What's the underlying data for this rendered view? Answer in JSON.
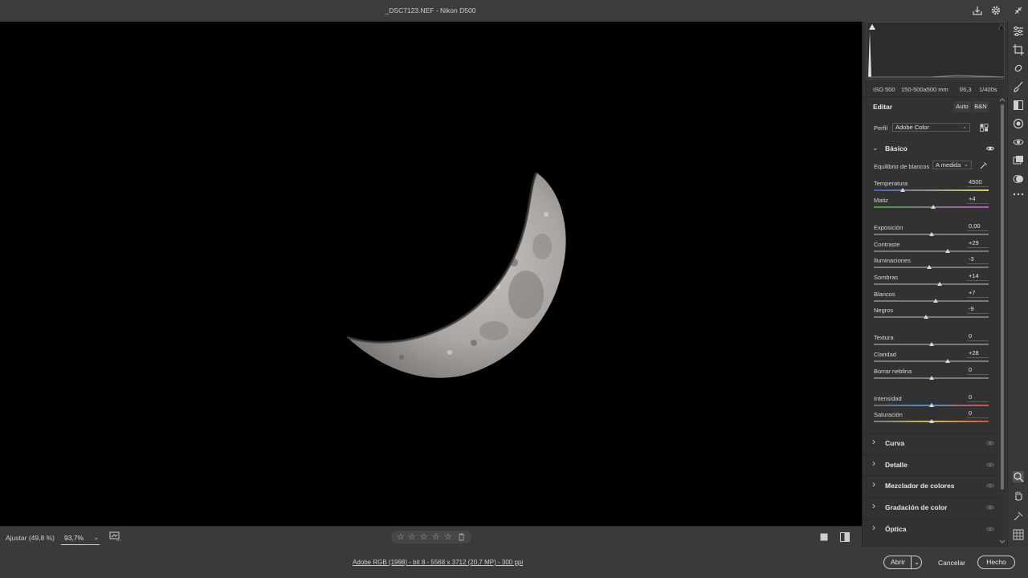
{
  "window": {
    "title": "_DSC7123.NEF -  Nikon D500"
  },
  "titlebar_icons": [
    "save-icon",
    "gear-icon",
    "minimize-icon"
  ],
  "exif": {
    "iso": "ISO 500",
    "lens": "150-500a500 mm",
    "aperture": "f/6,3",
    "shutter": "1/400s"
  },
  "edit": {
    "title": "Editar",
    "auto_label": "Auto",
    "bw_label": "B&N",
    "profile_label": "Perfil",
    "profile_value": "Adobe Color"
  },
  "basic": {
    "title": "Básico",
    "wb_label": "Equilibrio de blancos",
    "wb_value": "A medida",
    "sliders": [
      {
        "label": "Temperatura",
        "value": "4500",
        "level": 0.25,
        "track": "temp"
      },
      {
        "label": "Matiz",
        "value": "+4",
        "level": 0.52,
        "track": "tint"
      },
      {
        "label": "Exposición",
        "value": "0,00",
        "level": 0.5,
        "track": "plain"
      },
      {
        "label": "Contraste",
        "value": "+29",
        "level": 0.645,
        "track": "plain"
      },
      {
        "label": "Iluminaciones",
        "value": "-3",
        "level": 0.485,
        "track": "plain"
      },
      {
        "label": "Sombras",
        "value": "+14",
        "level": 0.57,
        "track": "plain"
      },
      {
        "label": "Blancos",
        "value": "+7",
        "level": 0.535,
        "track": "plain"
      },
      {
        "label": "Negros",
        "value": "-9",
        "level": 0.455,
        "track": "plain"
      },
      {
        "label": "Textura",
        "value": "0",
        "level": 0.5,
        "track": "plain"
      },
      {
        "label": "Claridad",
        "value": "+28",
        "level": 0.64,
        "track": "plain"
      },
      {
        "label": "Borrar neblina",
        "value": "0",
        "level": 0.5,
        "track": "plain"
      },
      {
        "label": "Intensidad",
        "value": "0",
        "level": 0.5,
        "track": "vibrance"
      },
      {
        "label": "Saturación",
        "value": "0",
        "level": 0.5,
        "track": "saturation"
      }
    ]
  },
  "sections": [
    "Curva",
    "Detalle",
    "Mezclador de colores",
    "Gradación de color",
    "Óptica"
  ],
  "bottom": {
    "fit_label": "Ajustar (49,8 %)",
    "zoom_value": "93,7%",
    "rating_stars": 5,
    "rating_value": 0
  },
  "footer": {
    "info": "Adobe RGB (1998) - bit 8 - 5568 x 3712 (20,7 MP) - 300 ppi",
    "open_label": "Abrir",
    "cancel_label": "Cancelar",
    "done_label": "Hecho"
  },
  "rail_icons": [
    "edit-icon",
    "crop-icon",
    "healing-icon",
    "brush-icon",
    "gradient-icon",
    "radial-icon",
    "redeye-icon",
    "snapshots-icon",
    "presets-icon",
    "more-icon"
  ],
  "rail_tools": [
    "zoom-icon",
    "hand-icon",
    "sampler-icon",
    "grid-icon"
  ],
  "colors": {
    "background": "#3a3a3a",
    "panel": "#323232",
    "canvas": "#000000",
    "accent_text": "#e6e6e6"
  }
}
